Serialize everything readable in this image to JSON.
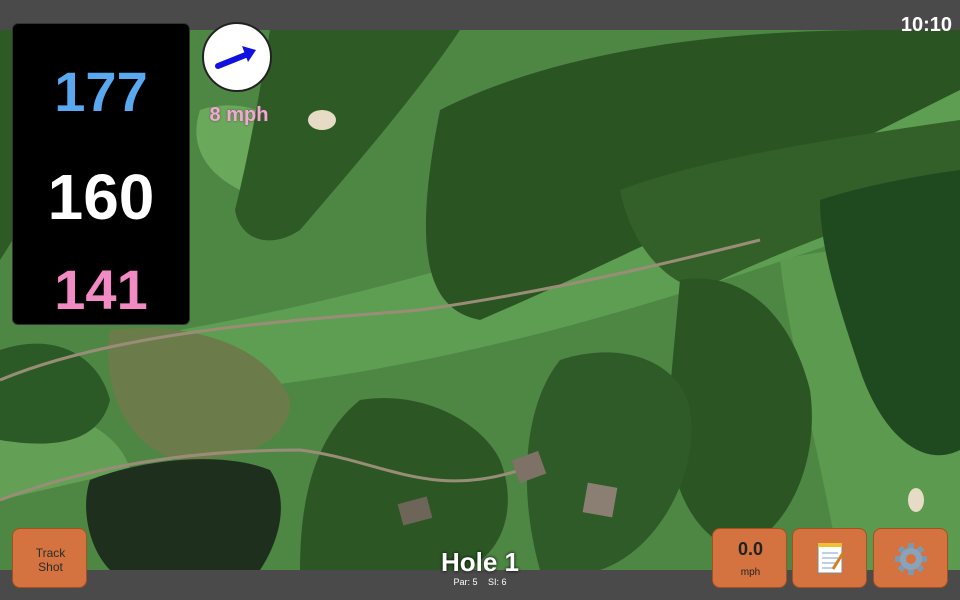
{
  "status": {
    "time": "10:10"
  },
  "distances": {
    "back": "177",
    "middle": "160",
    "front": "141"
  },
  "wind": {
    "speed_label": "8 mph",
    "arrow_color": "#1010e0"
  },
  "buttons": {
    "track_shot_line1": "Track",
    "track_shot_line2": "Shot",
    "speed_value": "0.0",
    "speed_unit": "mph",
    "notes_icon": "notepad-icon",
    "settings_icon": "gear-icon"
  },
  "hole": {
    "title": "Hole 1",
    "par": "Par: 5",
    "si": "SI: 6"
  },
  "colors": {
    "accent_button": "#d4733f",
    "back_distance": "#5aa8f0",
    "front_distance": "#f28ac4",
    "wind_label": "#f2a7d8"
  }
}
